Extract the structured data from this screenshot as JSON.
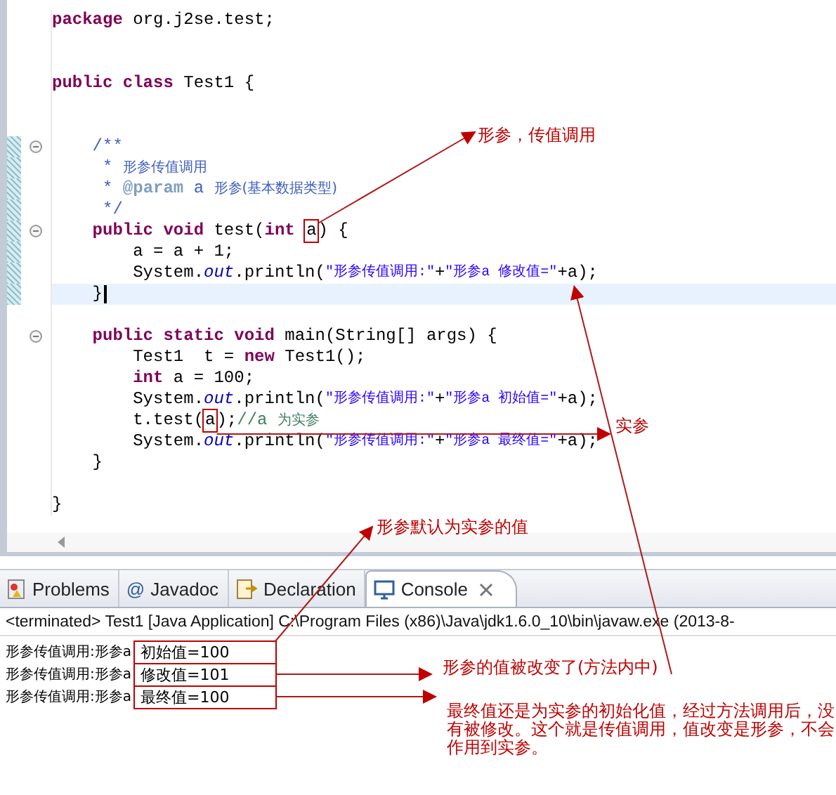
{
  "editor": {
    "lines": [
      {
        "kind": "code",
        "tokens": [
          {
            "kind": "kw",
            "text": "package"
          },
          {
            "kind": "plain",
            "text": " org.j2se.test;"
          }
        ]
      },
      {
        "kind": "blank"
      },
      {
        "kind": "blank"
      },
      {
        "kind": "code",
        "tokens": [
          {
            "kind": "kw",
            "text": "public class"
          },
          {
            "kind": "plain",
            "text": " Test1 {"
          }
        ]
      },
      {
        "kind": "blank"
      },
      {
        "kind": "blank"
      },
      {
        "kind": "code",
        "modified": true,
        "fold": true,
        "tokens": [
          {
            "kind": "doc",
            "text": "    /**"
          }
        ]
      },
      {
        "kind": "code",
        "modified": true,
        "tokens": [
          {
            "kind": "doc",
            "text": "     * "
          },
          {
            "kind": "doccjk",
            "text": "形参传值调用"
          }
        ]
      },
      {
        "kind": "code",
        "modified": true,
        "tokens": [
          {
            "kind": "doc",
            "text": "     * "
          },
          {
            "kind": "doctag",
            "text": "@param"
          },
          {
            "kind": "doc",
            "text": " a "
          },
          {
            "kind": "doccjk",
            "text": "形参(基本数据类型)"
          }
        ]
      },
      {
        "kind": "code",
        "modified": true,
        "tokens": [
          {
            "kind": "doc",
            "text": "     */"
          }
        ]
      },
      {
        "kind": "code",
        "modified": true,
        "fold": true,
        "tokens": [
          {
            "kind": "kw",
            "text": "    public void"
          },
          {
            "kind": "plain",
            "text": " test("
          },
          {
            "kind": "kw",
            "text": "int "
          },
          {
            "kind": "plain",
            "text": "a",
            "boxed": true
          },
          {
            "kind": "plain",
            "text": ") {"
          }
        ]
      },
      {
        "kind": "code",
        "modified": true,
        "tokens": [
          {
            "kind": "plain",
            "text": "        a = a + 1;"
          }
        ]
      },
      {
        "kind": "code",
        "modified": true,
        "tokens": [
          {
            "kind": "plain",
            "text": "        System."
          },
          {
            "kind": "field",
            "text": "out"
          },
          {
            "kind": "plain",
            "text": ".println("
          },
          {
            "kind": "string",
            "text": "\"形参传值调用:\""
          },
          {
            "kind": "plain",
            "text": "+"
          },
          {
            "kind": "string",
            "text": "\"形参a 修改值=\""
          },
          {
            "kind": "plain",
            "text": "+a);"
          }
        ]
      },
      {
        "kind": "code",
        "modified": true,
        "current": true,
        "tokens": [
          {
            "kind": "plain",
            "text": "    }"
          }
        ]
      },
      {
        "kind": "blank"
      },
      {
        "kind": "code",
        "fold": true,
        "tokens": [
          {
            "kind": "kw",
            "text": "    public static void"
          },
          {
            "kind": "plain",
            "text": " main(String[] args) {"
          }
        ]
      },
      {
        "kind": "code",
        "tokens": [
          {
            "kind": "plain",
            "text": "        Test1  t = "
          },
          {
            "kind": "kw",
            "text": "new"
          },
          {
            "kind": "plain",
            "text": " Test1();"
          }
        ]
      },
      {
        "kind": "code",
        "tokens": [
          {
            "kind": "kw",
            "text": "        int"
          },
          {
            "kind": "plain",
            "text": " a = 100;"
          }
        ]
      },
      {
        "kind": "code",
        "tokens": [
          {
            "kind": "plain",
            "text": "        System."
          },
          {
            "kind": "field",
            "text": "out"
          },
          {
            "kind": "plain",
            "text": ".println("
          },
          {
            "kind": "string",
            "text": "\"形参传值调用:\""
          },
          {
            "kind": "plain",
            "text": "+"
          },
          {
            "kind": "string",
            "text": "\"形参a 初始值=\""
          },
          {
            "kind": "plain",
            "text": "+a);"
          }
        ]
      },
      {
        "kind": "code",
        "tokens": [
          {
            "kind": "plain",
            "text": "        t.test("
          },
          {
            "kind": "plain",
            "text": "a",
            "boxed": true
          },
          {
            "kind": "plain",
            "text": ");"
          },
          {
            "kind": "comment",
            "text": "//a "
          },
          {
            "kind": "commentcjk",
            "text": "为实参"
          }
        ]
      },
      {
        "kind": "code",
        "tokens": [
          {
            "kind": "plain",
            "text": "        System."
          },
          {
            "kind": "field",
            "text": "out"
          },
          {
            "kind": "plain",
            "text": ".println("
          },
          {
            "kind": "string",
            "text": "\"形参传值调用:\""
          },
          {
            "kind": "plain",
            "text": "+"
          },
          {
            "kind": "string",
            "text": "\"形参a 最终值=\""
          },
          {
            "kind": "plain",
            "text": "+a);"
          }
        ]
      },
      {
        "kind": "code",
        "tokens": [
          {
            "kind": "plain",
            "text": "    }"
          }
        ]
      },
      {
        "kind": "blank"
      },
      {
        "kind": "code",
        "tokens": [
          {
            "kind": "plain",
            "text": "}"
          }
        ]
      }
    ]
  },
  "console": {
    "tabs": [
      {
        "kind": "problems",
        "label": "Problems",
        "selected": false
      },
      {
        "kind": "javadoc",
        "icon": "@",
        "label": "Javadoc",
        "selected": false
      },
      {
        "kind": "declaration",
        "label": "Declaration",
        "selected": false
      },
      {
        "kind": "console",
        "label": "Console",
        "selected": true
      }
    ],
    "status": "<terminated> Test1 [Java Application] C:\\Program Files (x86)\\Java\\jdk1.6.0_10\\bin\\javaw.exe (2013-8-",
    "output": [
      {
        "prefix": "形参传值调用:形参a",
        "value": "初始值=100",
        "boxed": true
      },
      {
        "prefix": "形参传值调用:形参a",
        "value": "修改值=101",
        "boxed": true
      },
      {
        "prefix": "形参传值调用:形参a",
        "value": "最终值=100",
        "boxed": true
      }
    ]
  },
  "annotations": [
    {
      "text": "形参，传值调用"
    },
    {
      "text": "实参"
    },
    {
      "text": "形参默认为实参的值"
    },
    {
      "text": "形参的值被改变了(方法内中)"
    },
    {
      "text": "最终值还是为实参的初始化值，经过方法调用后，没有被修改。这个就是传值调用，值改变是形参，不会作用到实参。"
    }
  ]
}
